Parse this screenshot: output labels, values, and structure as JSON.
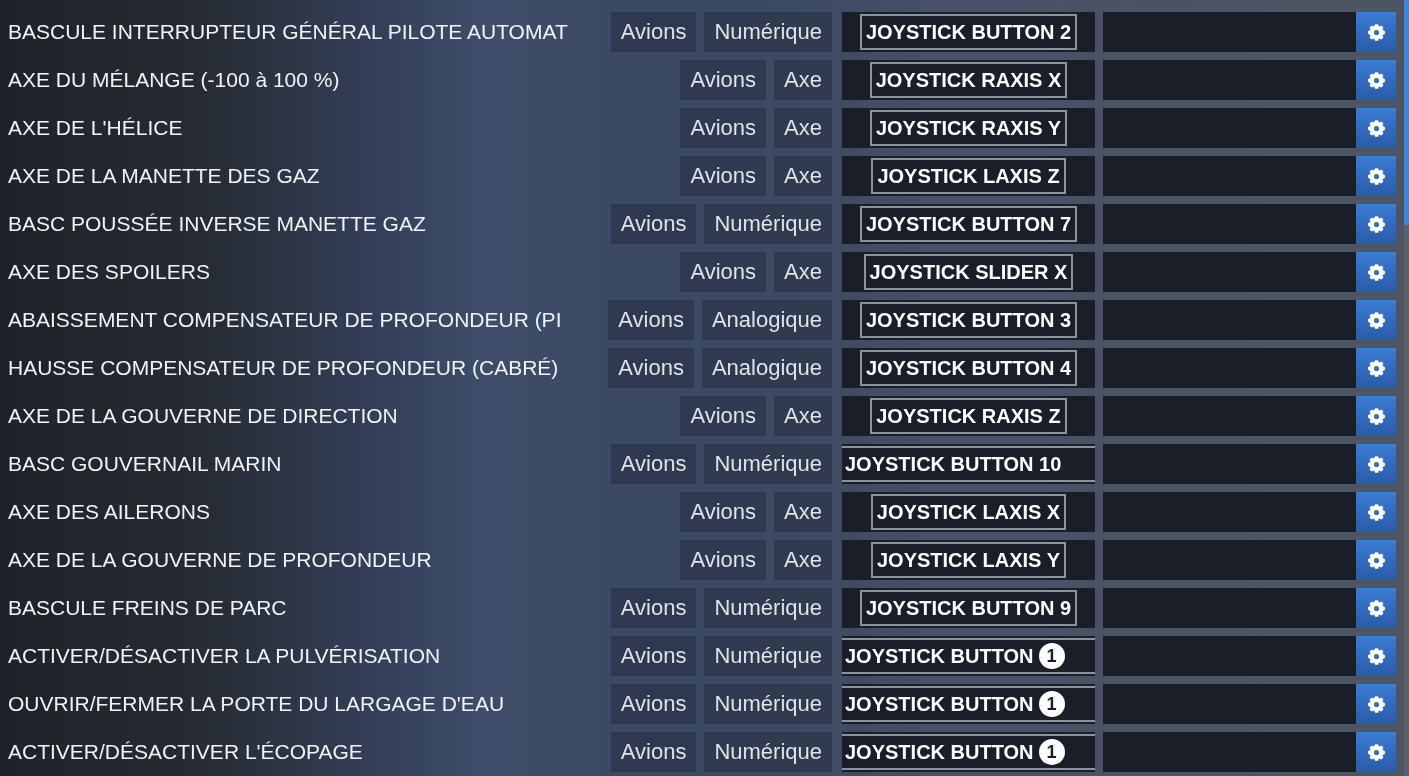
{
  "rows": [
    {
      "label": "BASCULE INTERRUPTEUR GÉNÉRAL PILOTE AUTOMAT",
      "tags": [
        "Avions",
        "Numérique"
      ],
      "binding": {
        "kind": "boxed",
        "text": "JOYSTICK BUTTON 2"
      }
    },
    {
      "label": "AXE DU MÉLANGE (-100 à 100 %)",
      "tags": [
        "Avions",
        "Axe"
      ],
      "binding": {
        "kind": "boxed",
        "text": "JOYSTICK RAXIS X"
      }
    },
    {
      "label": "AXE DE L'HÉLICE",
      "tags": [
        "Avions",
        "Axe"
      ],
      "binding": {
        "kind": "boxed",
        "text": "JOYSTICK RAXIS Y"
      }
    },
    {
      "label": "AXE DE LA MANETTE DES GAZ",
      "tags": [
        "Avions",
        "Axe"
      ],
      "binding": {
        "kind": "boxed",
        "text": "JOYSTICK LAXIS Z"
      }
    },
    {
      "label": "BASC POUSSÉE INVERSE MANETTE GAZ",
      "tags": [
        "Avions",
        "Numérique"
      ],
      "binding": {
        "kind": "boxed",
        "text": "JOYSTICK BUTTON 7"
      }
    },
    {
      "label": "AXE DES SPOILERS",
      "tags": [
        "Avions",
        "Axe"
      ],
      "binding": {
        "kind": "boxed",
        "text": "JOYSTICK SLIDER X"
      }
    },
    {
      "label": "ABAISSEMENT COMPENSATEUR DE PROFONDEUR (PI",
      "tags": [
        "Avions",
        "Analogique"
      ],
      "binding": {
        "kind": "boxed",
        "text": "JOYSTICK BUTTON 3"
      }
    },
    {
      "label": "HAUSSE COMPENSATEUR DE PROFONDEUR (CABRÉ)",
      "tags": [
        "Avions",
        "Analogique"
      ],
      "binding": {
        "kind": "boxed",
        "text": "JOYSTICK BUTTON 4"
      }
    },
    {
      "label": "AXE DE LA GOUVERNE DE DIRECTION",
      "tags": [
        "Avions",
        "Axe"
      ],
      "binding": {
        "kind": "boxed",
        "text": "JOYSTICK RAXIS Z"
      }
    },
    {
      "label": "BASC GOUVERNAIL MARIN",
      "tags": [
        "Avions",
        "Numérique"
      ],
      "binding": {
        "kind": "clipped",
        "text": "JOYSTICK BUTTON 10"
      }
    },
    {
      "label": "AXE DES AILERONS",
      "tags": [
        "Avions",
        "Axe"
      ],
      "binding": {
        "kind": "boxed",
        "text": "JOYSTICK LAXIS X"
      }
    },
    {
      "label": "AXE DE LA GOUVERNE DE PROFONDEUR",
      "tags": [
        "Avions",
        "Axe"
      ],
      "binding": {
        "kind": "boxed",
        "text": "JOYSTICK LAXIS Y"
      }
    },
    {
      "label": "BASCULE FREINS DE PARC",
      "tags": [
        "Avions",
        "Numérique"
      ],
      "binding": {
        "kind": "boxed",
        "text": "JOYSTICK BUTTON 9"
      }
    },
    {
      "label": "ACTIVER/DÉSACTIVER LA PULVÉRISATION",
      "tags": [
        "Avions",
        "Numérique"
      ],
      "binding": {
        "kind": "clipped",
        "text": "JOYSTICK BUTTON",
        "badge": "1"
      }
    },
    {
      "label": "OUVRIR/FERMER LA PORTE DU LARGAGE D'EAU",
      "tags": [
        "Avions",
        "Numérique"
      ],
      "binding": {
        "kind": "clipped",
        "text": "JOYSTICK BUTTON",
        "badge": "1"
      }
    },
    {
      "label": "ACTIVER/DÉSACTIVER L'ÉCOPAGE",
      "tags": [
        "Avions",
        "Numérique"
      ],
      "binding": {
        "kind": "clipped",
        "text": "JOYSTICK BUTTON",
        "badge": "1"
      }
    }
  ]
}
